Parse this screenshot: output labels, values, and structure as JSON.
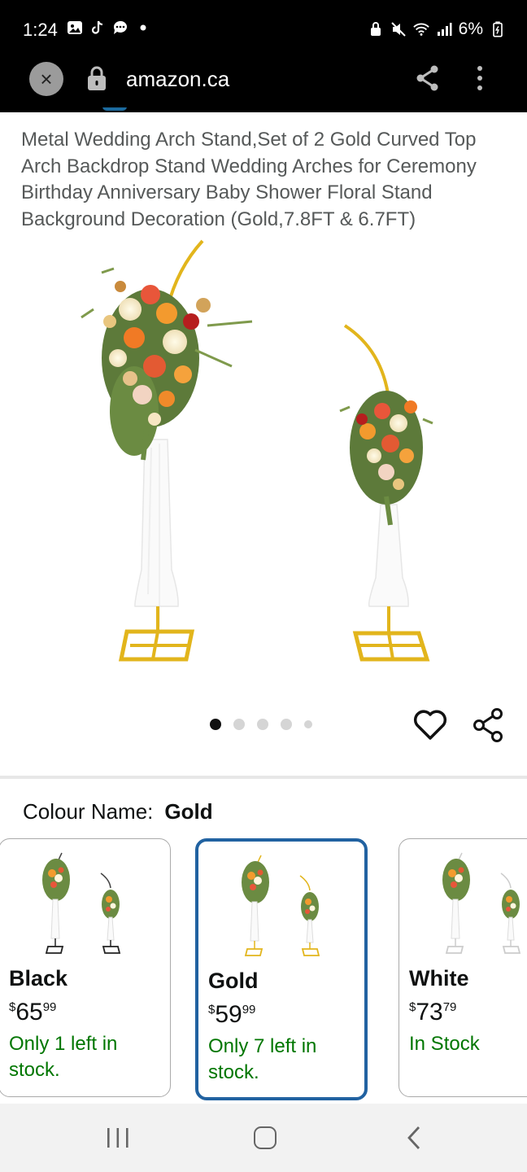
{
  "status_bar": {
    "time": "1:24",
    "battery": "6%",
    "icons_left": [
      "image-icon",
      "tiktok-icon",
      "chat-icon",
      "dot-icon"
    ],
    "icons_right": [
      "lock-icon",
      "mute-icon",
      "wifi-icon",
      "signal-icon",
      "battery-icon"
    ]
  },
  "browser": {
    "close_label": "×",
    "url": "amazon.ca"
  },
  "product": {
    "title": "Metal Wedding Arch Stand,Set of 2 Gold Curved Top Arch Backdrop Stand Wedding Arches for Ceremony Birthday Anniversary Baby Shower Floral Stand Background Decoration (Gold,7.8FT & 6.7FT)"
  },
  "carousel": {
    "total": 5,
    "active_index": 0
  },
  "variant": {
    "label": "Colour Name:",
    "selected": "Gold",
    "options": [
      {
        "name": "Black",
        "currency": "$",
        "dollars": "65",
        "cents": "99",
        "stock": "Only 1 left in stock.",
        "frame_color": "#222222"
      },
      {
        "name": "Gold",
        "currency": "$",
        "dollars": "59",
        "cents": "99",
        "stock": "Only 7 left in stock.",
        "frame_color": "#e5b914"
      },
      {
        "name": "White",
        "currency": "$",
        "dollars": "73",
        "cents": "79",
        "stock": "In Stock",
        "frame_color": "#dddddd"
      }
    ]
  },
  "colors": {
    "accent": "#2162a1",
    "stock_green": "#007600",
    "gold": "#e5b914"
  }
}
